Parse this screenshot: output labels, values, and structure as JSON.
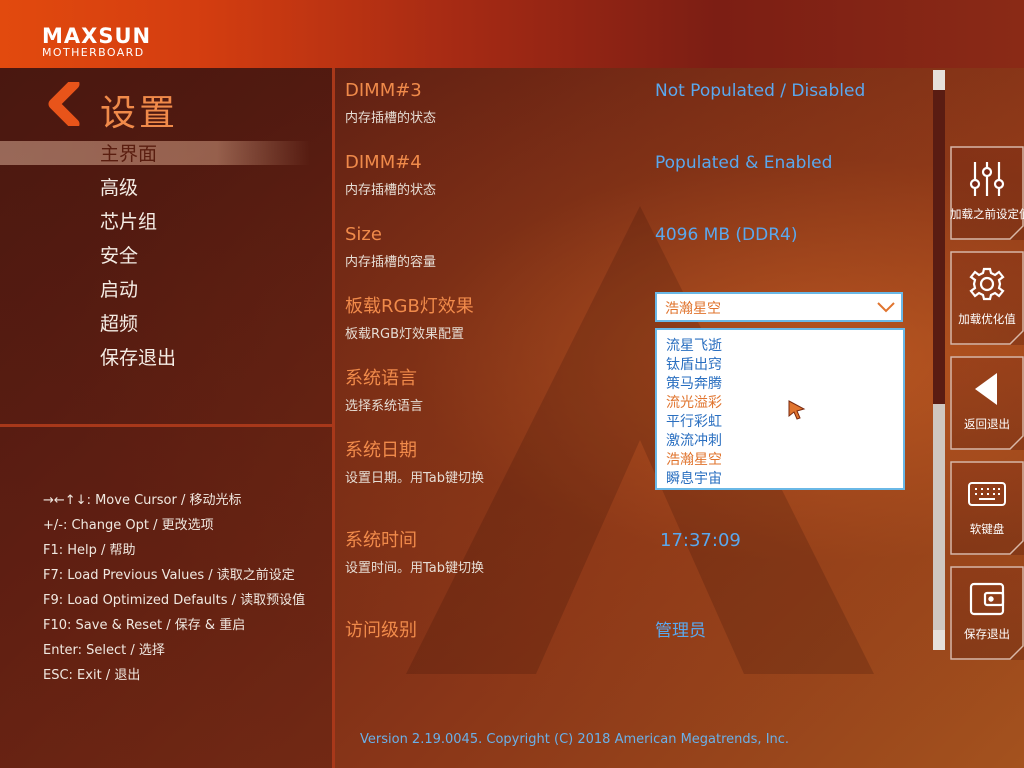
{
  "brand": {
    "name": "MAXSUN",
    "subtitle": "MOTHERBOARD"
  },
  "page_title": "设置",
  "menu": [
    {
      "label": "主界面",
      "active": true
    },
    {
      "label": "高级",
      "active": false
    },
    {
      "label": "芯片组",
      "active": false
    },
    {
      "label": "安全",
      "active": false
    },
    {
      "label": "启动",
      "active": false
    },
    {
      "label": "超频",
      "active": false
    },
    {
      "label": "保存退出",
      "active": false
    }
  ],
  "help": [
    "→←↑↓: Move Cursor  /  移动光标",
    "+/-:  Change Opt  /  更改选项",
    "F1:  Help  /  帮助",
    "F7:  Load Previous Values  /  读取之前设定",
    "F9:  Load Optimized Defaults  /  读取预设值",
    "F10:  Save & Reset  /  保存 & 重启",
    "Enter:  Select  /  选择",
    "ESC:  Exit  /  退出"
  ],
  "settings": [
    {
      "label": "DIMM#3",
      "desc": "内存插槽的状态",
      "value": "Not Populated / Disabled"
    },
    {
      "label": "DIMM#4",
      "desc": "内存插槽的状态",
      "value": "Populated & Enabled"
    },
    {
      "label": "Size",
      "desc": "内存插槽的容量",
      "value": "4096 MB (DDR4)"
    },
    {
      "label": "板载RGB灯效果",
      "desc": "板载RGB灯效果配置",
      "value": "浩瀚星空"
    },
    {
      "label": "系统语言",
      "desc": "选择系统语言",
      "value": ""
    },
    {
      "label": "系统日期",
      "desc": "设置日期。用Tab键切换",
      "value": ""
    },
    {
      "label": "系统时间",
      "desc": "设置时间。用Tab键切换",
      "value": "17:37:09"
    },
    {
      "label": "访问级别",
      "desc": "",
      "value": "管理员"
    }
  ],
  "rgb_dropdown": {
    "selected": "浩瀚星空",
    "options": [
      "流星飞逝",
      "钛盾出窍",
      "策马奔腾",
      "流光溢彩",
      "平行彩虹",
      "激流冲刺",
      "浩瀚星空",
      "瞬息宇宙"
    ],
    "highlighted": [
      3,
      6
    ]
  },
  "side_buttons": [
    {
      "label": "加载之前设定值",
      "icon": "sliders-icon"
    },
    {
      "label": "加载优化值",
      "icon": "gear-icon"
    },
    {
      "label": "返回退出",
      "icon": "back-triangle-icon"
    },
    {
      "label": "软键盘",
      "icon": "keyboard-icon"
    },
    {
      "label": "保存退出",
      "icon": "wallet-icon"
    }
  ],
  "version": "Version 2.19.0045. Copyright (C) 2018 American Megatrends, Inc.",
  "colors": {
    "accent_orange": "#f08a4a",
    "value_blue": "#5aa8ee",
    "dropdown_border": "#6ab8e6",
    "header_orange": "#e24a0e"
  }
}
